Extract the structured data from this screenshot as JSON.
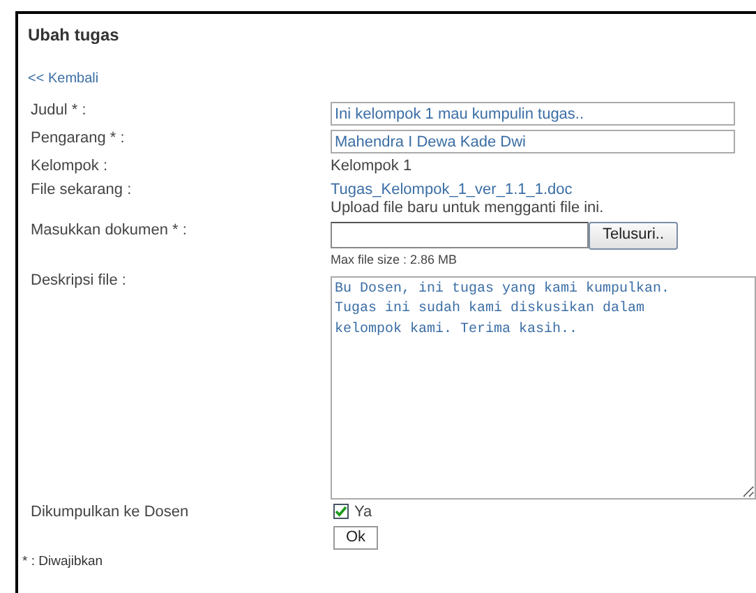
{
  "title": "Ubah tugas",
  "back_link": "<< Kembali",
  "fields": [
    {
      "kind": "text",
      "label": "Judul * :",
      "value": "Ini kelompok 1 mau kumpulin tugas.."
    },
    {
      "kind": "text",
      "label": "Pengarang * :",
      "value": "Mahendra I Dewa Kade Dwi"
    },
    {
      "kind": "static",
      "label": "Kelompok :",
      "value": "Kelompok 1"
    },
    {
      "kind": "file-link",
      "label": "File sekarang :",
      "value": "Tugas_Kelompok_1_ver_1.1_1.doc",
      "note": "Upload file baru untuk mengganti file ini."
    },
    {
      "kind": "upload",
      "label": "Masukkan dokumen * :",
      "button": "Telusuri..",
      "note": "Max file size : 2.86 MB"
    },
    {
      "kind": "textarea",
      "label": "Deskripsi file :",
      "value": "Bu Dosen, ini tugas yang kami kumpulkan.\nTugas ini sudah kami diskusikan dalam\nkelompok kami. Terima kasih.."
    },
    {
      "kind": "checkbox",
      "label": "Dikumpulkan ke Dosen",
      "option": "Ya",
      "checked": true
    }
  ],
  "submit": "Ok",
  "footnote": "* : Diwajibkan"
}
